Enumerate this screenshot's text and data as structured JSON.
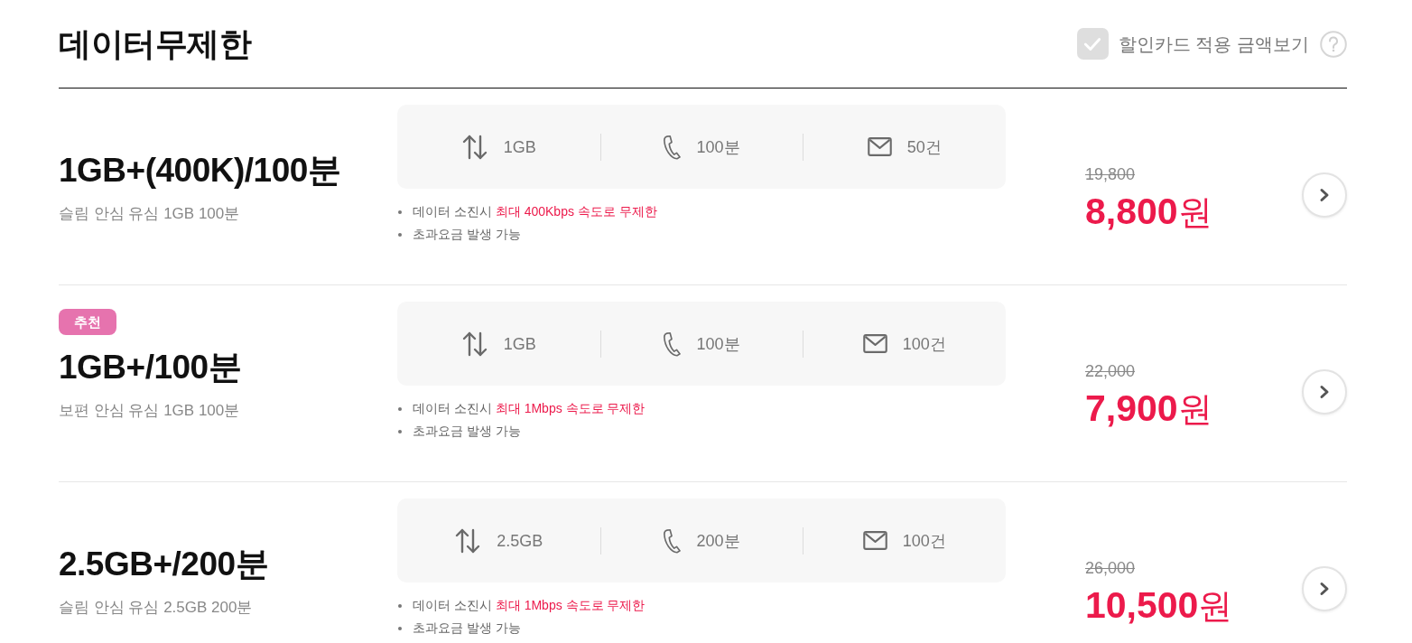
{
  "header": {
    "title": "데이터무제한",
    "discount_toggle": {
      "label": "할인카드 적용 금액보기",
      "checked": false
    }
  },
  "plans": [
    {
      "name": "1GB+(400K)/100분",
      "subtitle": "슬림 안심 유심 1GB 100분",
      "specs": [
        {
          "kind": "data",
          "value": "1GB"
        },
        {
          "kind": "voice",
          "value": "100분"
        },
        {
          "kind": "sms",
          "value": "50건"
        }
      ],
      "notes": [
        {
          "text": "데이터 소진시",
          "highlight": "최대 400Kbps 속도로 무제한"
        },
        {
          "text": "초과요금 발생 가능"
        }
      ],
      "original_price": "19,800",
      "price": "8,800",
      "currency": "원"
    },
    {
      "badge": "추천",
      "name": "1GB+/100분",
      "subtitle": "보편 안심 유심 1GB 100분",
      "specs": [
        {
          "kind": "data",
          "value": "1GB"
        },
        {
          "kind": "voice",
          "value": "100분"
        },
        {
          "kind": "sms",
          "value": "100건"
        }
      ],
      "notes": [
        {
          "text": "데이터 소진시",
          "highlight": "최대 1Mbps 속도로 무제한"
        },
        {
          "text": "초과요금 발생 가능"
        }
      ],
      "original_price": "22,000",
      "price": "7,900",
      "currency": "원"
    },
    {
      "name": "2.5GB+/200분",
      "subtitle": "슬림 안심 유심 2.5GB 200분",
      "specs": [
        {
          "kind": "data",
          "value": "2.5GB"
        },
        {
          "kind": "voice",
          "value": "200분"
        },
        {
          "kind": "sms",
          "value": "100건"
        }
      ],
      "notes": [
        {
          "text": "데이터 소진시",
          "highlight": "최대 1Mbps 속도로 무제한"
        },
        {
          "text": "초과요금 발생 가능"
        }
      ],
      "original_price": "26,000",
      "price": "10,500",
      "currency": "원"
    }
  ]
}
